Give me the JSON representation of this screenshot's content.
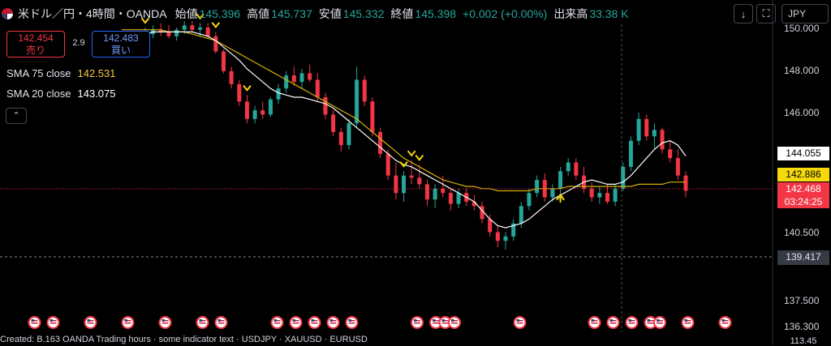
{
  "header": {
    "symbol": "米ドル／円・4時間・OANDA",
    "open_label": "始値",
    "open": "145.396",
    "high_label": "高値",
    "high": "145.737",
    "low_label": "安値",
    "low": "145.332",
    "close_label": "終値",
    "close": "145.398",
    "change": "+0.002 (+0.00%)",
    "volume_label": "出来高",
    "volume": "33.38 K"
  },
  "toolbar": {
    "down_icon": "↓",
    "maximize_icon": "⛶",
    "currency": "JPY"
  },
  "trade": {
    "sell_price": "142.454",
    "sell_label": "売り",
    "spread": "2.9",
    "buy_price": "142.483",
    "buy_label": "買い"
  },
  "indicators": [
    {
      "label": "SMA 75 close",
      "value": "142.531",
      "color": "#f5c842"
    },
    {
      "label": "SMA 20 close",
      "value": "143.075",
      "color": "#ffffff"
    }
  ],
  "collapse_icon": "⌃",
  "axis": {
    "labels": [
      "150.000",
      "148.000",
      "146.000",
      "140.500",
      "137.500",
      "136.300"
    ]
  },
  "price_tags": {
    "sma20": "144.055",
    "sma75": "142.886",
    "last": "142.468",
    "countdown": "03:24:25",
    "crosshair": "139.417",
    "bottom_partial": "113.45"
  },
  "bottom_strip_text": "Created: B.163 OANDA  Trading hours  ·  some indicator text  ·  USDJPY  ·  XAUUSD  ·  EURUSD",
  "colors": {
    "up": "#26a69a",
    "down": "#f23645",
    "sma20": "#ffffff",
    "sma75": "#d4b106",
    "signal": "#f5d90a"
  },
  "chart_data": {
    "type": "candlestick",
    "y_axis_range": [
      136.3,
      150.0
    ],
    "candles": [
      [
        149.2,
        149.5,
        148.9,
        149.3
      ],
      [
        149.3,
        149.6,
        149.0,
        149.4
      ],
      [
        149.4,
        149.8,
        149.2,
        149.6
      ],
      [
        149.6,
        150.0,
        149.4,
        149.7
      ],
      [
        149.7,
        150.1,
        149.5,
        149.9
      ],
      [
        149.9,
        150.2,
        149.6,
        149.8
      ],
      [
        149.8,
        150.1,
        149.5,
        149.6
      ],
      [
        149.6,
        150.0,
        149.4,
        149.9
      ],
      [
        149.9,
        150.3,
        149.7,
        150.1
      ],
      [
        150.1,
        150.3,
        149.8,
        149.9
      ],
      [
        149.9,
        150.2,
        149.6,
        150.0
      ],
      [
        150.0,
        150.2,
        149.5,
        149.6
      ],
      [
        149.6,
        149.8,
        148.8,
        148.9
      ],
      [
        148.9,
        149.0,
        147.9,
        148.0
      ],
      [
        148.0,
        148.2,
        147.2,
        147.4
      ],
      [
        147.4,
        147.6,
        146.4,
        146.6
      ],
      [
        146.6,
        146.9,
        145.6,
        145.8
      ],
      [
        145.8,
        146.4,
        145.6,
        146.2
      ],
      [
        146.2,
        146.6,
        145.8,
        146.0
      ],
      [
        146.0,
        146.8,
        145.9,
        146.7
      ],
      [
        146.7,
        147.4,
        146.5,
        147.2
      ],
      [
        147.2,
        148.0,
        147.0,
        147.8
      ],
      [
        147.8,
        148.2,
        147.3,
        147.5
      ],
      [
        147.5,
        148.1,
        147.2,
        147.9
      ],
      [
        147.9,
        148.3,
        147.5,
        147.6
      ],
      [
        147.6,
        147.9,
        146.6,
        146.8
      ],
      [
        146.8,
        147.0,
        145.8,
        146.0
      ],
      [
        146.0,
        146.2,
        145.0,
        145.2
      ],
      [
        145.2,
        145.4,
        144.3,
        144.6
      ],
      [
        144.6,
        145.8,
        144.4,
        145.6
      ],
      [
        145.6,
        148.2,
        145.4,
        147.6
      ],
      [
        147.6,
        147.8,
        146.4,
        146.6
      ],
      [
        146.6,
        146.8,
        145.0,
        145.2
      ],
      [
        145.2,
        145.4,
        144.0,
        144.2
      ],
      [
        144.2,
        144.4,
        143.0,
        143.2
      ],
      [
        143.2,
        143.8,
        142.1,
        142.4
      ],
      [
        142.4,
        143.4,
        142.0,
        143.2
      ],
      [
        143.2,
        143.9,
        142.8,
        143.1
      ],
      [
        143.1,
        143.7,
        142.6,
        142.8
      ],
      [
        142.8,
        143.0,
        141.8,
        142.1
      ],
      [
        142.1,
        142.8,
        141.7,
        142.6
      ],
      [
        142.6,
        143.2,
        142.2,
        142.4
      ],
      [
        142.4,
        142.6,
        141.6,
        141.9
      ],
      [
        141.9,
        142.6,
        141.7,
        142.4
      ],
      [
        142.4,
        142.6,
        141.8,
        142.0
      ],
      [
        142.0,
        142.3,
        141.6,
        141.8
      ],
      [
        141.8,
        142.0,
        141.0,
        141.2
      ],
      [
        141.2,
        141.4,
        140.4,
        140.6
      ],
      [
        140.6,
        140.9,
        139.9,
        140.2
      ],
      [
        140.2,
        140.6,
        139.8,
        140.4
      ],
      [
        140.4,
        141.2,
        140.2,
        141.0
      ],
      [
        141.0,
        142.0,
        140.8,
        141.8
      ],
      [
        141.8,
        142.6,
        141.6,
        142.4
      ],
      [
        142.4,
        143.2,
        142.2,
        143.0
      ],
      [
        143.0,
        143.3,
        142.0,
        142.2
      ],
      [
        142.2,
        142.8,
        142.0,
        142.6
      ],
      [
        142.6,
        143.6,
        142.4,
        143.4
      ],
      [
        143.4,
        144.0,
        143.2,
        143.8
      ],
      [
        143.8,
        144.0,
        143.0,
        143.2
      ],
      [
        143.2,
        143.6,
        142.4,
        142.6
      ],
      [
        142.6,
        142.9,
        142.0,
        142.2
      ],
      [
        142.2,
        142.7,
        141.9,
        142.4
      ],
      [
        142.4,
        142.8,
        141.9,
        142.0
      ],
      [
        142.0,
        142.8,
        141.8,
        142.6
      ],
      [
        142.6,
        143.8,
        142.5,
        143.6
      ],
      [
        143.6,
        145.0,
        143.4,
        144.8
      ],
      [
        144.8,
        146.1,
        144.6,
        145.8
      ],
      [
        145.8,
        146.0,
        144.8,
        145.0
      ],
      [
        145.0,
        145.6,
        144.4,
        145.3
      ],
      [
        145.3,
        145.4,
        144.2,
        144.4
      ],
      [
        144.4,
        144.8,
        143.8,
        144.0
      ],
      [
        144.0,
        144.4,
        143.0,
        143.2
      ],
      [
        143.2,
        143.4,
        142.2,
        142.5
      ]
    ],
    "sma20": [
      149.4,
      149.5,
      149.6,
      149.7,
      149.8,
      149.8,
      149.8,
      149.8,
      149.8,
      149.8,
      149.7,
      149.6,
      149.4,
      149.1,
      148.8,
      148.5,
      148.1,
      147.8,
      147.5,
      147.2,
      147.0,
      146.9,
      146.8,
      146.8,
      146.7,
      146.6,
      146.5,
      146.3,
      146.0,
      145.7,
      145.4,
      145.1,
      144.8,
      144.5,
      144.2,
      143.9,
      143.7,
      143.6,
      143.4,
      143.2,
      143.0,
      142.8,
      142.6,
      142.4,
      142.2,
      142.0,
      141.6,
      141.2,
      140.9,
      140.8,
      140.9,
      141.0,
      141.2,
      141.5,
      141.8,
      142.1,
      142.3,
      142.5,
      142.7,
      142.9,
      143.0,
      142.9,
      142.8,
      142.8,
      142.9,
      143.2,
      143.6,
      144.0,
      144.4,
      144.7,
      144.8,
      144.6,
      144.1
    ],
    "sma75": [
      149.9,
      149.9,
      149.9,
      149.9,
      149.9,
      149.9,
      149.8,
      149.8,
      149.8,
      149.7,
      149.6,
      149.5,
      149.4,
      149.2,
      149.0,
      148.8,
      148.6,
      148.4,
      148.2,
      148.0,
      147.8,
      147.6,
      147.4,
      147.2,
      147.0,
      146.8,
      146.6,
      146.4,
      146.2,
      146.0,
      145.8,
      145.5,
      145.2,
      144.9,
      144.6,
      144.3,
      144.0,
      143.8,
      143.6,
      143.4,
      143.2,
      143.0,
      142.9,
      142.8,
      142.7,
      142.7,
      142.6,
      142.6,
      142.5,
      142.5,
      142.5,
      142.5,
      142.5,
      142.6,
      142.6,
      142.6,
      142.6,
      142.7,
      142.7,
      142.7,
      142.7,
      142.7,
      142.7,
      142.7,
      142.7,
      142.7,
      142.8,
      142.8,
      142.8,
      142.8,
      142.9,
      142.9,
      142.9
    ],
    "signals": [
      {
        "index": 3,
        "dir": "down"
      },
      {
        "index": 10,
        "dir": "down"
      },
      {
        "index": 12,
        "dir": "down"
      },
      {
        "index": 16,
        "dir": "down"
      },
      {
        "index": 36,
        "dir": "down"
      },
      {
        "index": 37,
        "dir": "down"
      },
      {
        "index": 38,
        "dir": "down"
      },
      {
        "index": 56,
        "dir": "up"
      }
    ],
    "events": [
      3,
      5,
      9,
      13,
      17,
      21,
      23,
      29,
      31,
      33,
      35,
      37,
      44,
      46,
      47,
      48,
      55,
      63,
      65,
      67,
      69,
      70,
      73,
      77
    ]
  }
}
